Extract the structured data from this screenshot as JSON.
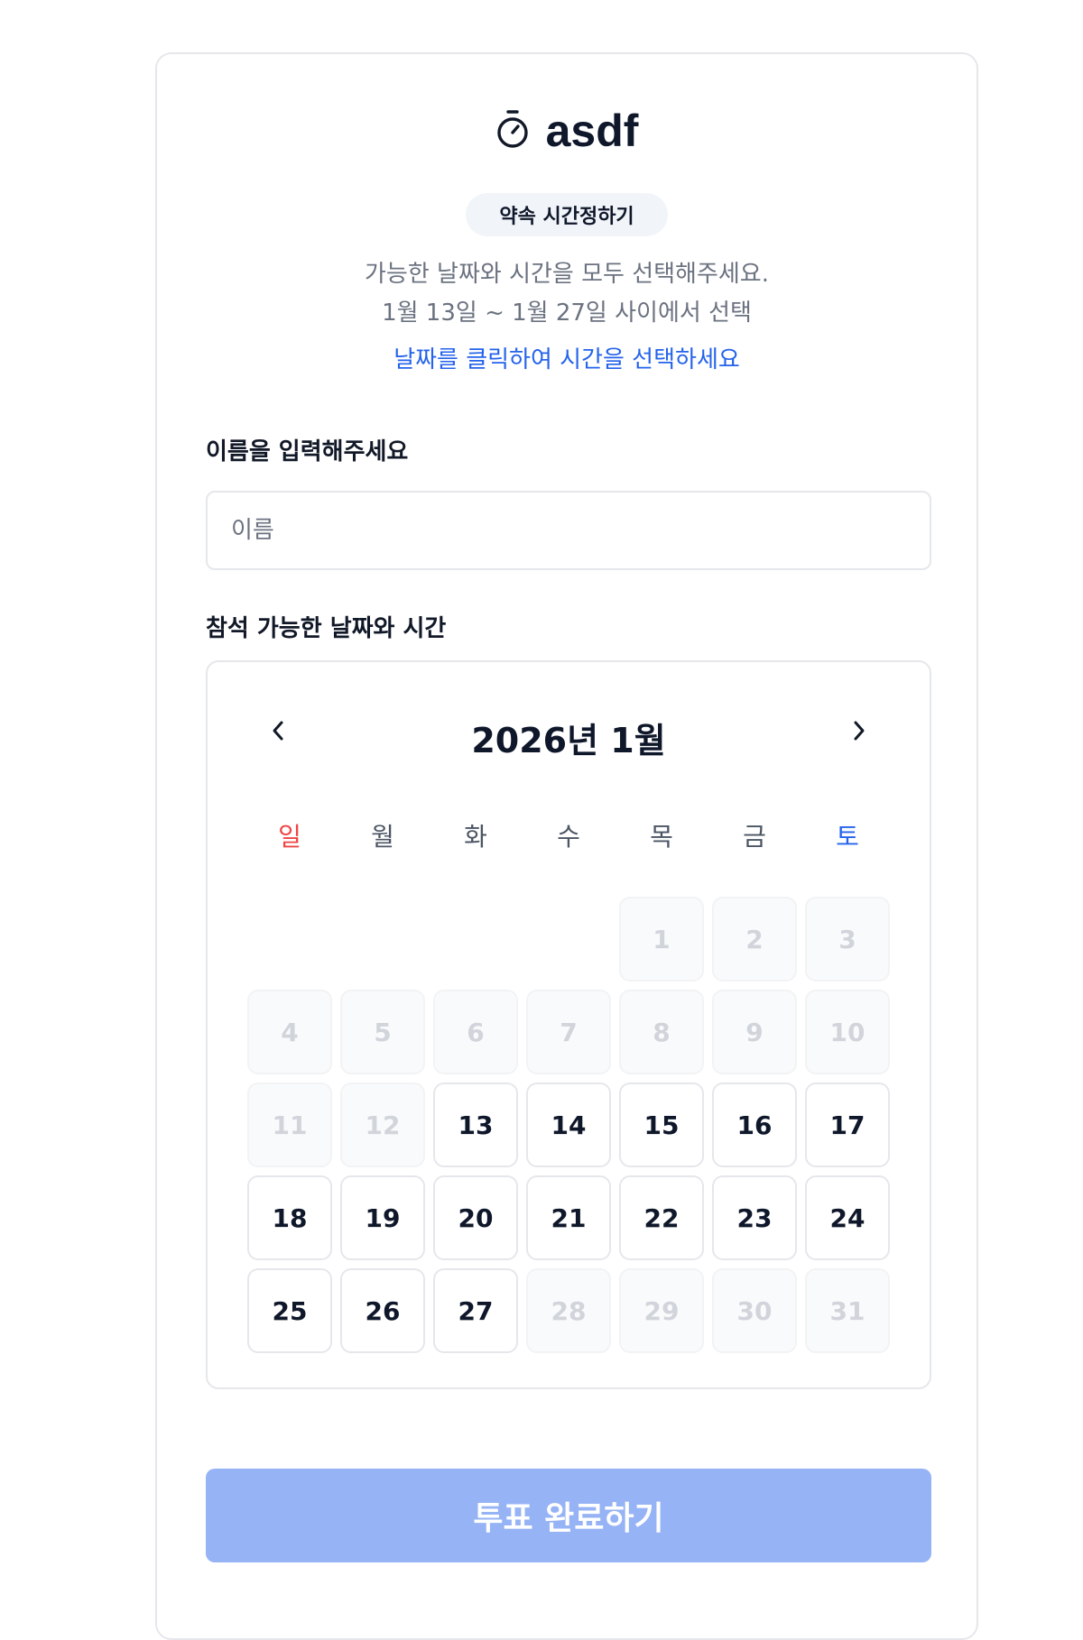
{
  "event": {
    "icon": "stopwatch-icon",
    "title": "asdf",
    "badge": "약속 시간정하기",
    "instructions": "가능한 날짜와 시간을 모두 선택해주세요.",
    "range": "1월 13일 ~ 1월 27일 사이에서 선택",
    "hint": "날짜를 클릭하여 시간을 선택하세요"
  },
  "name_field": {
    "label": "이름을 입력해주세요",
    "placeholder": "이름",
    "value": ""
  },
  "availability": {
    "label": "참석 가능한 날짜와 시간"
  },
  "calendar": {
    "month_label": "2026년 1월",
    "prev_icon": "chevron-left-icon",
    "next_icon": "chevron-right-icon",
    "weekdays": [
      "일",
      "월",
      "화",
      "수",
      "목",
      "금",
      "토"
    ],
    "leading_blanks": 4,
    "days": [
      {
        "label": "1",
        "enabled": false
      },
      {
        "label": "2",
        "enabled": false
      },
      {
        "label": "3",
        "enabled": false
      },
      {
        "label": "4",
        "enabled": false
      },
      {
        "label": "5",
        "enabled": false
      },
      {
        "label": "6",
        "enabled": false
      },
      {
        "label": "7",
        "enabled": false
      },
      {
        "label": "8",
        "enabled": false
      },
      {
        "label": "9",
        "enabled": false
      },
      {
        "label": "10",
        "enabled": false
      },
      {
        "label": "11",
        "enabled": false
      },
      {
        "label": "12",
        "enabled": false
      },
      {
        "label": "13",
        "enabled": true
      },
      {
        "label": "14",
        "enabled": true
      },
      {
        "label": "15",
        "enabled": true
      },
      {
        "label": "16",
        "enabled": true
      },
      {
        "label": "17",
        "enabled": true
      },
      {
        "label": "18",
        "enabled": true
      },
      {
        "label": "19",
        "enabled": true
      },
      {
        "label": "20",
        "enabled": true
      },
      {
        "label": "21",
        "enabled": true
      },
      {
        "label": "22",
        "enabled": true
      },
      {
        "label": "23",
        "enabled": true
      },
      {
        "label": "24",
        "enabled": true
      },
      {
        "label": "25",
        "enabled": true
      },
      {
        "label": "26",
        "enabled": true
      },
      {
        "label": "27",
        "enabled": true
      },
      {
        "label": "28",
        "enabled": false
      },
      {
        "label": "29",
        "enabled": false
      },
      {
        "label": "30",
        "enabled": false
      },
      {
        "label": "31",
        "enabled": false
      }
    ]
  },
  "submit": {
    "label": "투표 완료하기",
    "enabled": false
  },
  "colors": {
    "accent": "#2563eb",
    "sunday": "#ef4444",
    "saturday": "#2563eb",
    "submit_disabled": "#96b3f5"
  }
}
